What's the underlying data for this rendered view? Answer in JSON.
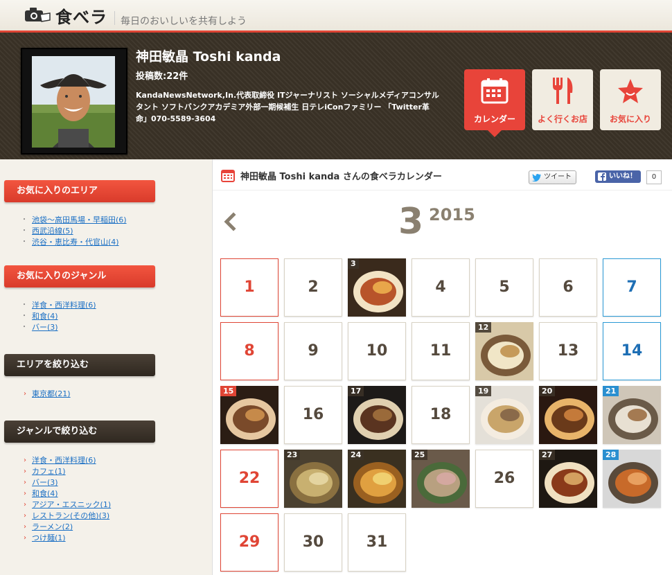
{
  "header": {
    "logo_text": "食べラ",
    "tagline": "毎日のおいしいを共有しよう"
  },
  "profile": {
    "name": "神田敏晶 Toshi kanda",
    "post_count": "投稿数:22件",
    "bio": "KandaNewsNetwork,In.代表取締役 ITジャーナリスト ソーシャルメディアコンサルタント ソフトバンクアカデミア外部一期候補生 日テレiConファミリー 「Twitter革命」070-5589-3604",
    "tabs": {
      "calendar": "カレンダー",
      "shops": "よく行くお店",
      "favorites": "お気に入り"
    }
  },
  "sidebar": {
    "fav_area": {
      "title": "お気に入りのエリア",
      "items": [
        "池袋～高田馬場・早稲田(6)",
        "西武沿線(5)",
        "渋谷・恵比寿・代官山(4)"
      ]
    },
    "fav_genre": {
      "title": "お気に入りのジャンル",
      "items": [
        "洋食・西洋料理(6)",
        "和食(4)",
        "バー(3)"
      ]
    },
    "filter_area": {
      "title": "エリアを絞り込む",
      "items": [
        "東京都(21)"
      ]
    },
    "filter_genre": {
      "title": "ジャンルで絞り込む",
      "items": [
        "洋食・西洋料理(6)",
        "カフェ(1)",
        "バー(3)",
        "和食(4)",
        "アジア・エスニック(1)",
        "レストラン(その他)(3)",
        "ラーメン(2)",
        "つけ麺(1)"
      ]
    }
  },
  "calendar": {
    "title": "神田敏晶 Toshi kanda さんの食べラカレンダー",
    "tweet": "ツイート",
    "like": "いいね！",
    "like_count": "0",
    "month": "3",
    "year": "2015",
    "days": [
      {
        "d": "1",
        "photo": false
      },
      {
        "d": "2",
        "photo": false
      },
      {
        "d": "3",
        "photo": true
      },
      {
        "d": "4",
        "photo": false
      },
      {
        "d": "5",
        "photo": false
      },
      {
        "d": "6",
        "photo": false
      },
      {
        "d": "7",
        "photo": false
      },
      {
        "d": "8",
        "photo": false
      },
      {
        "d": "9",
        "photo": false
      },
      {
        "d": "10",
        "photo": false
      },
      {
        "d": "11",
        "photo": false
      },
      {
        "d": "12",
        "photo": true
      },
      {
        "d": "13",
        "photo": false
      },
      {
        "d": "14",
        "photo": false
      },
      {
        "d": "15",
        "photo": true
      },
      {
        "d": "16",
        "photo": false
      },
      {
        "d": "17",
        "photo": true
      },
      {
        "d": "18",
        "photo": false
      },
      {
        "d": "19",
        "photo": true
      },
      {
        "d": "20",
        "photo": true
      },
      {
        "d": "21",
        "photo": true
      },
      {
        "d": "22",
        "photo": false
      },
      {
        "d": "23",
        "photo": true
      },
      {
        "d": "24",
        "photo": true
      },
      {
        "d": "25",
        "photo": true
      },
      {
        "d": "26",
        "photo": false
      },
      {
        "d": "27",
        "photo": true
      },
      {
        "d": "28",
        "photo": true
      },
      {
        "d": "29",
        "photo": false
      },
      {
        "d": "30",
        "photo": false
      },
      {
        "d": "31",
        "photo": false
      }
    ],
    "colors": {
      "sunday": "#e04535",
      "saturday": "#1e6fb5",
      "weekday": "#554a3e"
    }
  }
}
